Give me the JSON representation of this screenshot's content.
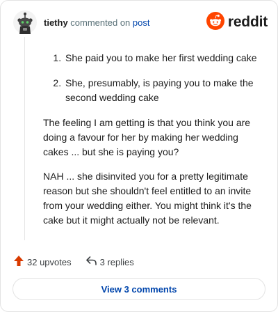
{
  "header": {
    "username": "tiethy",
    "action_text": "commented on",
    "post_link": "post",
    "logo_text": "reddit"
  },
  "comment": {
    "list_items": [
      "She paid you to make her first wedding cake",
      "She, presumably, is paying you to make the second wedding cake"
    ],
    "paragraphs": [
      "The feeling I am getting is that you think you are doing a favour for her by making her wedding cakes ... but she is paying you?",
      "NAH ... she disinvited you for a pretty legitimate reason but she shouldn't feel entitled to an invite from your wedding either. You might think it's the cake but it might actually not be relevant."
    ]
  },
  "actions": {
    "upvotes": "32 upvotes",
    "replies": "3 replies"
  },
  "view_comments_label": "View 3 comments",
  "colors": {
    "brand": "#FF4500",
    "link": "#0045AC",
    "upvote": "#D93A00"
  },
  "icons": [
    "avatar-icon",
    "reddit-logo-icon",
    "upvote-arrow-icon",
    "reply-arrow-icon"
  ]
}
